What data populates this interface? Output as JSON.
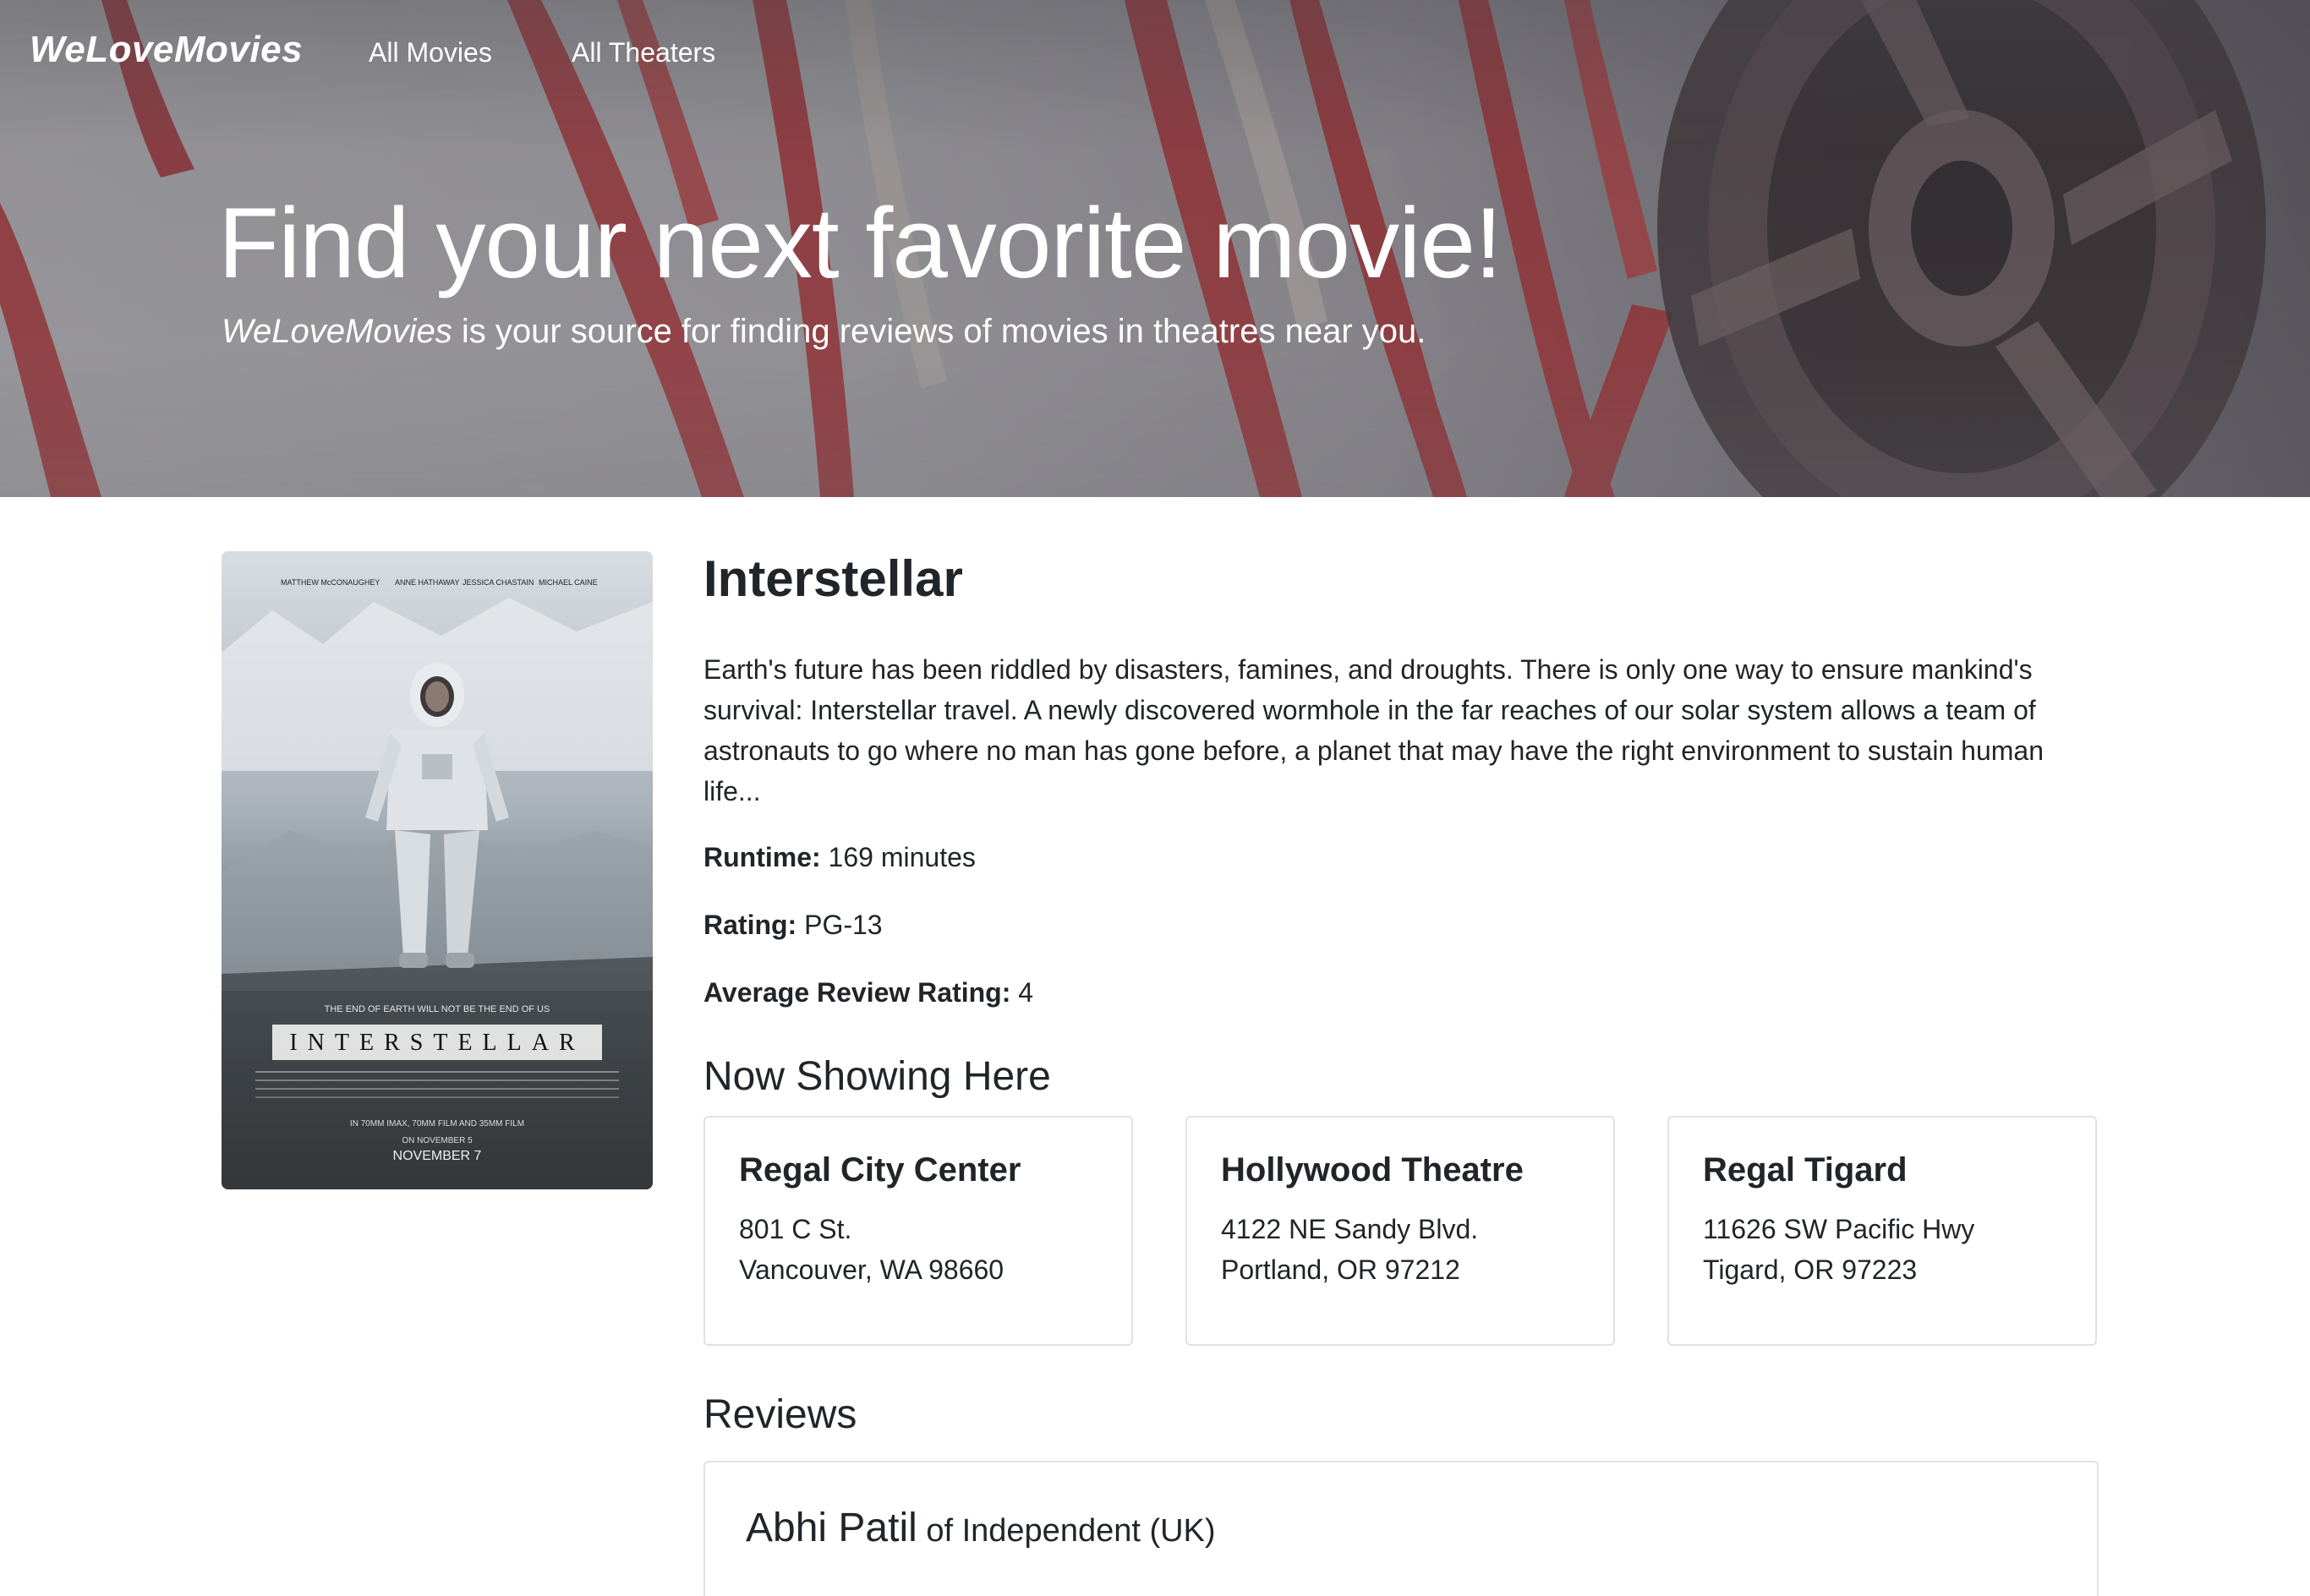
{
  "navbar": {
    "brand": "WeLoveMovies",
    "links": [
      {
        "label": "All Movies"
      },
      {
        "label": "All Theaters"
      }
    ]
  },
  "hero": {
    "title": "Find your next favorite movie!",
    "subtitle_brand": "WeLoveMovies",
    "subtitle_rest": " is your source for finding reviews of movies in theatres near you."
  },
  "movie": {
    "title": "Interstellar",
    "description": "Earth's future has been riddled by disasters, famines, and droughts. There is only one way to ensure mankind's survival: Interstellar travel. A newly discovered wormhole in the far reaches of our solar system allows a team of astronauts to go where no man has gone before, a planet that may have the right environment to sustain human life...",
    "runtime_label": "Runtime:",
    "runtime_value": " 169 minutes",
    "rating_label": "Rating:",
    "rating_value": " PG-13",
    "avg_label": "Average Review Rating:",
    "avg_value": " 4",
    "poster": {
      "cast": [
        "MATTHEW McCONAUGHEY",
        "ANNE HATHAWAY",
        "JESSICA CHASTAIN",
        "MICHAEL CAINE"
      ],
      "tagline": "THE END OF EARTH WILL NOT BE THE END OF US",
      "wordmark": "INTERSTELLAR",
      "formats": "IN 70MM IMAX, 70MM FILM AND 35MM FILM",
      "release_1": "ON NOVEMBER 5",
      "release_2": "NOVEMBER 7"
    }
  },
  "showing": {
    "heading": "Now Showing Here",
    "theaters": [
      {
        "name": "Regal City Center",
        "line1": "801 C St.",
        "line2": "Vancouver, WA 98660"
      },
      {
        "name": "Hollywood Theatre",
        "line1": "4122 NE Sandy Blvd.",
        "line2": "Portland, OR 97212"
      },
      {
        "name": "Regal Tigard",
        "line1": "11626 SW Pacific Hwy",
        "line2": "Tigard, OR 97223"
      }
    ]
  },
  "reviews": {
    "heading": "Reviews",
    "items": [
      {
        "critic": "Abhi Patil",
        "org": " of Independent (UK)"
      }
    ]
  },
  "colors": {
    "text": "#212529",
    "card_border": "#dee2e6",
    "hero_text": "#ffffff",
    "film_red": "#b3262a"
  }
}
